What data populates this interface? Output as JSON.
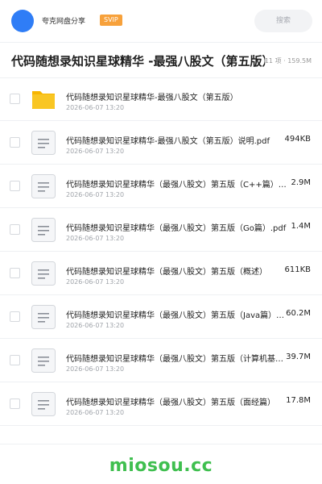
{
  "header": {
    "share_name": "夸克网盘分享",
    "badge": "SVIP",
    "search_placeholder": "搜索"
  },
  "folder": {
    "title": "代码随想录知识星球精华 -最强八股文（第五版）",
    "meta": "11 项 · 159.5M"
  },
  "files": [
    {
      "type": "folder",
      "name": "代码随想录知识星球精华-最强八股文（第五版）",
      "date": "2026-06-07 13:20",
      "size": ""
    },
    {
      "type": "doc",
      "name": "代码随想录知识星球精华-最强八股文（第五版）说明.pdf",
      "date": "2026-06-07 13:20",
      "size": "494KB"
    },
    {
      "type": "doc",
      "name": "代码随想录知识星球精华（最强八股文）第五版（C++篇）.pdf",
      "date": "2026-06-07 13:20",
      "size": "2.9M"
    },
    {
      "type": "doc",
      "name": "代码随想录知识星球精华（最强八股文）第五版（Go篇）.pdf",
      "date": "2026-06-07 13:20",
      "size": "1.4M"
    },
    {
      "type": "doc",
      "name": "代码随想录知识星球精华（最强八股文）第五版（概述）",
      "date": "2026-06-07 13:20",
      "size": "611KB"
    },
    {
      "type": "doc",
      "name": "代码随想录知识星球精华（最强八股文）第五版（Java篇）.pdf",
      "date": "2026-06-07 13:20",
      "size": "60.2M"
    },
    {
      "type": "doc",
      "name": "代码随想录知识星球精华（最强八股文）第五版（计算机基础）",
      "date": "2026-06-07 13:20",
      "size": "39.7M"
    },
    {
      "type": "doc",
      "name": "代码随想录知识星球精华（最强八股文）第五版（面经篇）",
      "date": "2026-06-07 13:20",
      "size": "17.8M"
    }
  ],
  "footer": {
    "watermark": "miosou.cc"
  },
  "colors": {
    "accent": "#2f7df6",
    "badge": "#f7a13b",
    "folder": "#f9c623",
    "watermark": "#3fbf4f"
  }
}
